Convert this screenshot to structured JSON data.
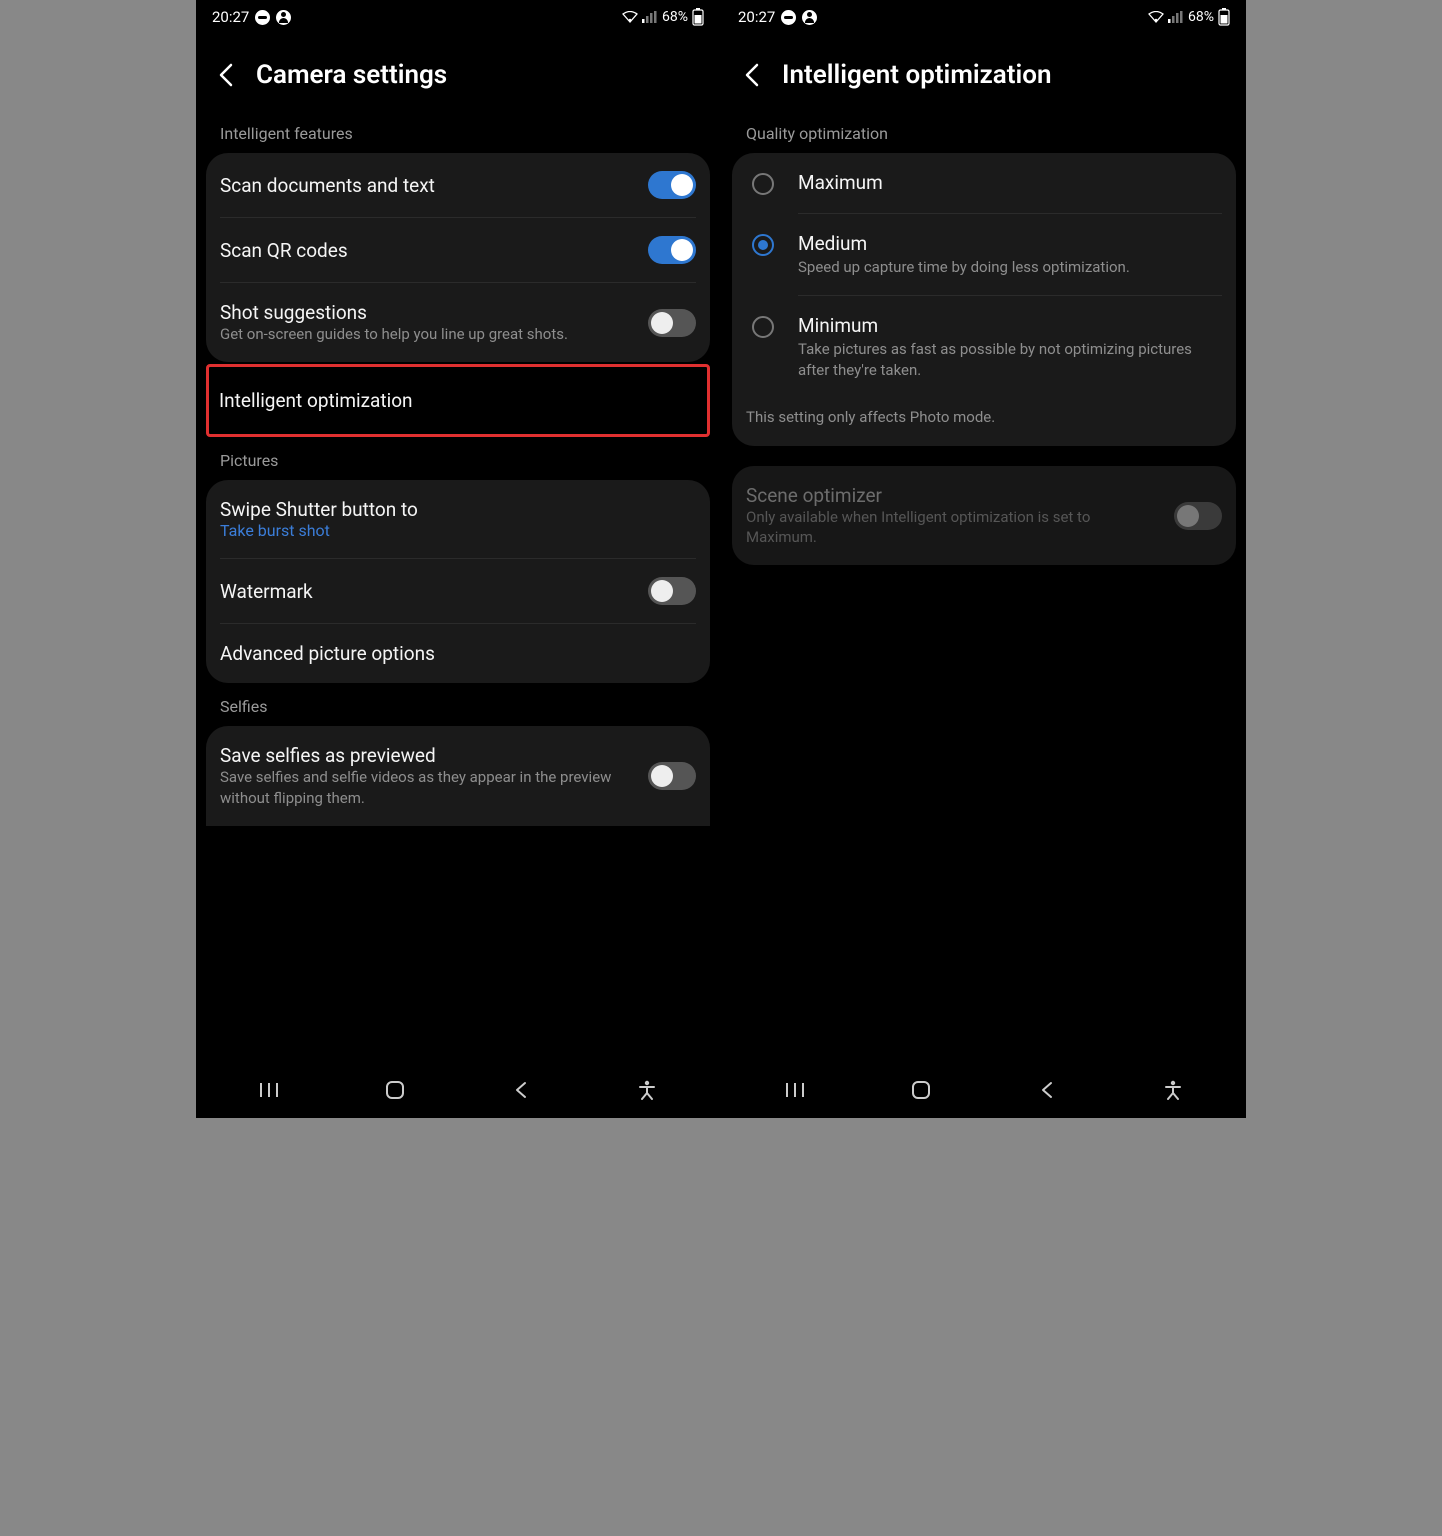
{
  "status": {
    "time": "20:27",
    "battery": "68%"
  },
  "left": {
    "title": "Camera settings",
    "sections": {
      "intelligent": {
        "label": "Intelligent features",
        "scanDocs": "Scan documents and text",
        "scanQR": "Scan QR codes",
        "shotSuggestions": {
          "title": "Shot suggestions",
          "sub": "Get on-screen guides to help you line up great shots."
        },
        "intelligentOptimization": "Intelligent optimization"
      },
      "pictures": {
        "label": "Pictures",
        "swipeShutter": {
          "title": "Swipe Shutter button to",
          "sub": "Take burst shot"
        },
        "watermark": "Watermark",
        "advanced": "Advanced picture options"
      },
      "selfies": {
        "label": "Selfies",
        "savePreviewed": {
          "title": "Save selfies as previewed",
          "sub": "Save selfies and selfie videos as they appear in the preview without flipping them."
        }
      }
    }
  },
  "right": {
    "title": "Intelligent optimization",
    "qualityLabel": "Quality optimization",
    "options": {
      "max": {
        "title": "Maximum"
      },
      "med": {
        "title": "Medium",
        "sub": "Speed up capture time by doing less optimization."
      },
      "min": {
        "title": "Minimum",
        "sub": "Take pictures as fast as possible by not optimizing pictures after they're taken."
      }
    },
    "note": "This setting only affects Photo mode.",
    "sceneOptimizer": {
      "title": "Scene optimizer",
      "sub": "Only available when Intelligent optimization is set to Maximum."
    }
  }
}
